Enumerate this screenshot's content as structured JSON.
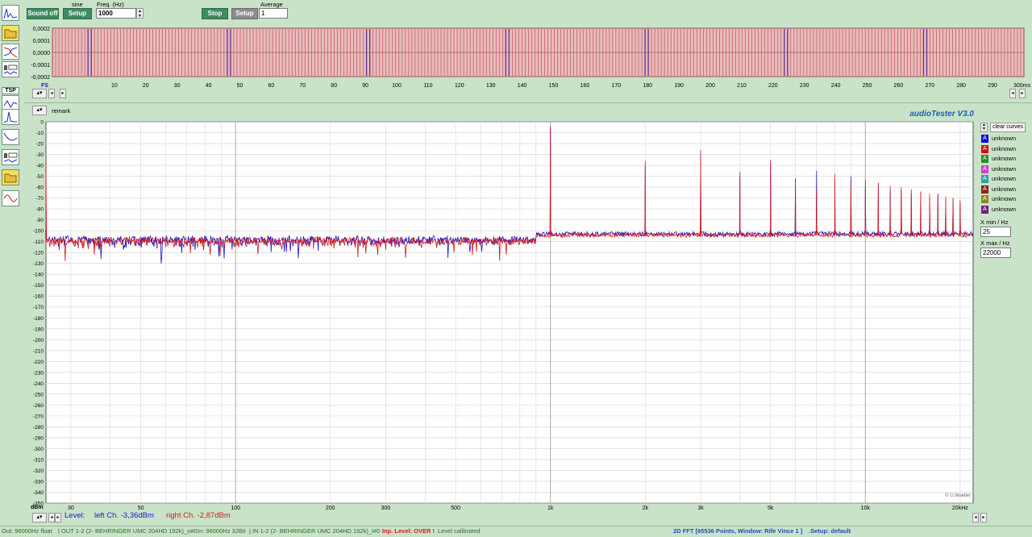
{
  "toolbar": {
    "waveform_label": "sine",
    "sound_off": "Sound off",
    "setup1": "Setup",
    "freq_label": "Freq. (Hz)",
    "freq_value": "1000",
    "stop": "Stop",
    "setup2": "Setup",
    "average_label": "Average",
    "average_value": "1"
  },
  "scope": {
    "y_ticks": [
      "0,0002",
      "0,0001",
      "0,0000",
      "-0,0001",
      "-0,0002"
    ],
    "x_start": "FS",
    "x_ticks": [
      "10",
      "20",
      "30",
      "40",
      "50",
      "60",
      "70",
      "80",
      "90",
      "100",
      "110",
      "120",
      "130",
      "140",
      "150",
      "160",
      "170",
      "180",
      "190",
      "200",
      "210",
      "220",
      "230",
      "240",
      "250",
      "260",
      "270",
      "280",
      "290"
    ],
    "x_end": "300ms"
  },
  "tsp_label": "TSP",
  "remark": "remark",
  "app_title": "audioTester  V3.0",
  "fft": {
    "y_unit": "dBm",
    "y_ticks": [
      "0",
      "-10",
      "-20",
      "-30",
      "-40",
      "-50",
      "-60",
      "-70",
      "-80",
      "-90",
      "-100",
      "-110",
      "-120",
      "-130",
      "-140",
      "-150",
      "-160",
      "-170",
      "-180",
      "-190",
      "-200",
      "-210",
      "-220",
      "-230",
      "-240",
      "-250",
      "-260",
      "-270",
      "-280",
      "-290",
      "-300",
      "-310",
      "-320",
      "-330",
      "-340",
      "-350"
    ],
    "x_ticks": [
      "30",
      "50",
      "100",
      "200",
      "300",
      "500",
      "1k",
      "2k",
      "3k",
      "5k",
      "10k",
      "20kHz"
    ],
    "credit": "© U.Mueller"
  },
  "legend": {
    "clear": "clear curves",
    "items": [
      {
        "letter": "A",
        "name": "unknown",
        "color": "#1010d0"
      },
      {
        "letter": "A",
        "name": "unknown",
        "color": "#d01010"
      },
      {
        "letter": "A",
        "name": "unknown",
        "color": "#2a8a2a"
      },
      {
        "letter": "A",
        "name": "unknown",
        "color": "#d040d0"
      },
      {
        "letter": "A",
        "name": "unknown",
        "color": "#30a0a0"
      },
      {
        "letter": "A",
        "name": "unknown",
        "color": "#902020"
      },
      {
        "letter": "A",
        "name": "unknown",
        "color": "#8a8a20"
      },
      {
        "letter": "A",
        "name": "unknown",
        "color": "#702080"
      }
    ],
    "xmin_label": "X min / Hz",
    "xmin_value": "25",
    "xmax_label": "X max / Hz",
    "xmax_value": "22000"
  },
  "level": {
    "label": "Level:",
    "left": "left Ch. -3,36dBm",
    "right": "right Ch. -2,87dBm"
  },
  "status": {
    "out": "Out: 96000Hz float",
    "out_dev": "| OUT 1-2 (2- BEHRINGER UMC 204HD 192k)_o#0",
    "in": "In: 96000Hz 32Bit",
    "in_dev": "| IN 1-2 (2- BEHRINGER UMC 204HD 192k)_i#0",
    "over": "Inp. Level: OVER !",
    "calibrated": "Level calibrated",
    "fft_info": "2D FFT [65536 Points, Window: Rife Vince 1 ]",
    "setup": ".Setup:  default"
  },
  "colors": {
    "left_channel": "#1818c8",
    "right_channel": "#d81818",
    "app_title": "#1a5fb4"
  }
}
